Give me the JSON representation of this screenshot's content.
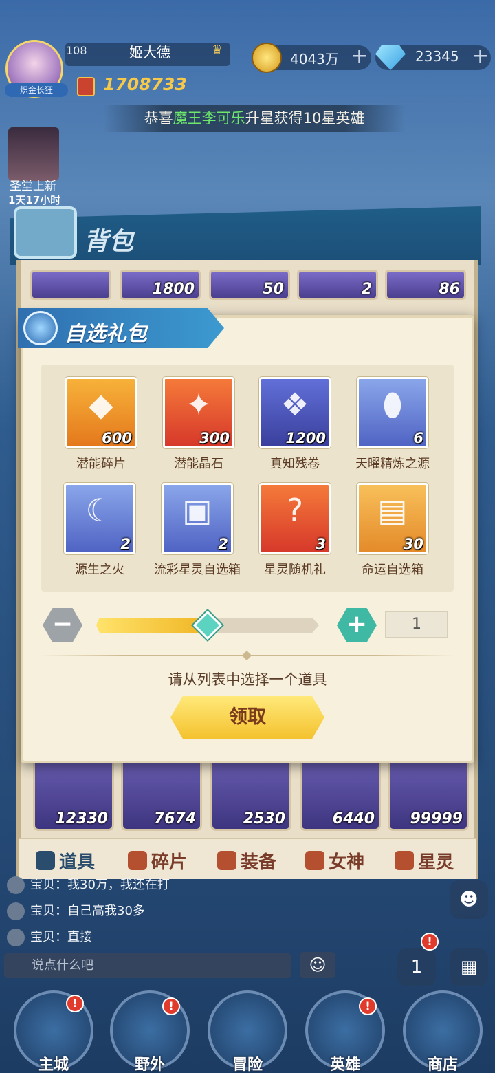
{
  "hud": {
    "avatar_badge": "炽金长狂",
    "level": "108",
    "player_name": "姬大德",
    "power": "1708733",
    "gold": "4043万",
    "diamond": "23345",
    "plus": "+",
    "rank_symbol": "♛"
  },
  "ticker": {
    "prefix": "恭喜",
    "highlight": "魔王李可乐",
    "suffix": "升星获得10星英雄"
  },
  "event": {
    "title": "圣堂上新",
    "time": "1天17小时"
  },
  "backpack": {
    "title": "背包",
    "top_row_counts": [
      "",
      "1800",
      "50",
      "2",
      "86"
    ],
    "bottom_row_counts": [
      "12330",
      "7674",
      "2530",
      "6440",
      "99999"
    ],
    "tabs": [
      {
        "label": "道具",
        "icon": "props-icon"
      },
      {
        "label": "碎片",
        "icon": "fragment-icon"
      },
      {
        "label": "装备",
        "icon": "equipment-icon"
      },
      {
        "label": "女神",
        "icon": "goddess-icon"
      },
      {
        "label": "星灵",
        "icon": "star-spirit-icon"
      }
    ]
  },
  "modal": {
    "title": "自选礼包",
    "items": [
      {
        "name": "潜能碎片",
        "count": "600",
        "bg": "orange",
        "icon": "potential-shard-icon",
        "sym": "◆"
      },
      {
        "name": "潜能晶石",
        "count": "300",
        "bg": "red",
        "icon": "potential-crystal-icon",
        "sym": "✦"
      },
      {
        "name": "真知残卷",
        "count": "1200",
        "bg": "blue",
        "icon": "scroll-icon",
        "sym": "❖"
      },
      {
        "name": "天曜精炼之源",
        "count": "6",
        "bg": "lblue",
        "icon": "refine-source-icon",
        "sym": "⬮"
      },
      {
        "name": "源生之火",
        "count": "2",
        "bg": "lblue",
        "icon": "origin-fire-icon",
        "sym": "☾"
      },
      {
        "name": "流彩星灵自选箱",
        "count": "2",
        "bg": "lblue",
        "icon": "star-spirit-chest-icon",
        "sym": "▣"
      },
      {
        "name": "星灵随机礼",
        "count": "3",
        "bg": "red",
        "icon": "random-gift-icon",
        "sym": "?"
      },
      {
        "name": "命运自选箱",
        "count": "30",
        "bg": "gold",
        "icon": "fate-chest-icon",
        "sym": "▤"
      }
    ],
    "slider_fraction": 0.5,
    "quantity": "1",
    "minus": "−",
    "plus": "+",
    "hint": "请从列表中选择一个道具",
    "claim_label": "领取"
  },
  "chat": {
    "lines": [
      "宝贝：我30万，我还在打",
      "宝贝：自己高我30多",
      "宝贝：直接"
    ],
    "placeholder": "说点什么吧",
    "emoji": "☺"
  },
  "nav": [
    {
      "label": "主城",
      "badge": "!"
    },
    {
      "label": "野外",
      "badge": "!"
    },
    {
      "label": "冒险",
      "badge": ""
    },
    {
      "label": "英雄",
      "badge": "!"
    },
    {
      "label": "商店",
      "badge": ""
    }
  ],
  "side": {
    "rank_badge": "!",
    "rank_label": "1"
  }
}
